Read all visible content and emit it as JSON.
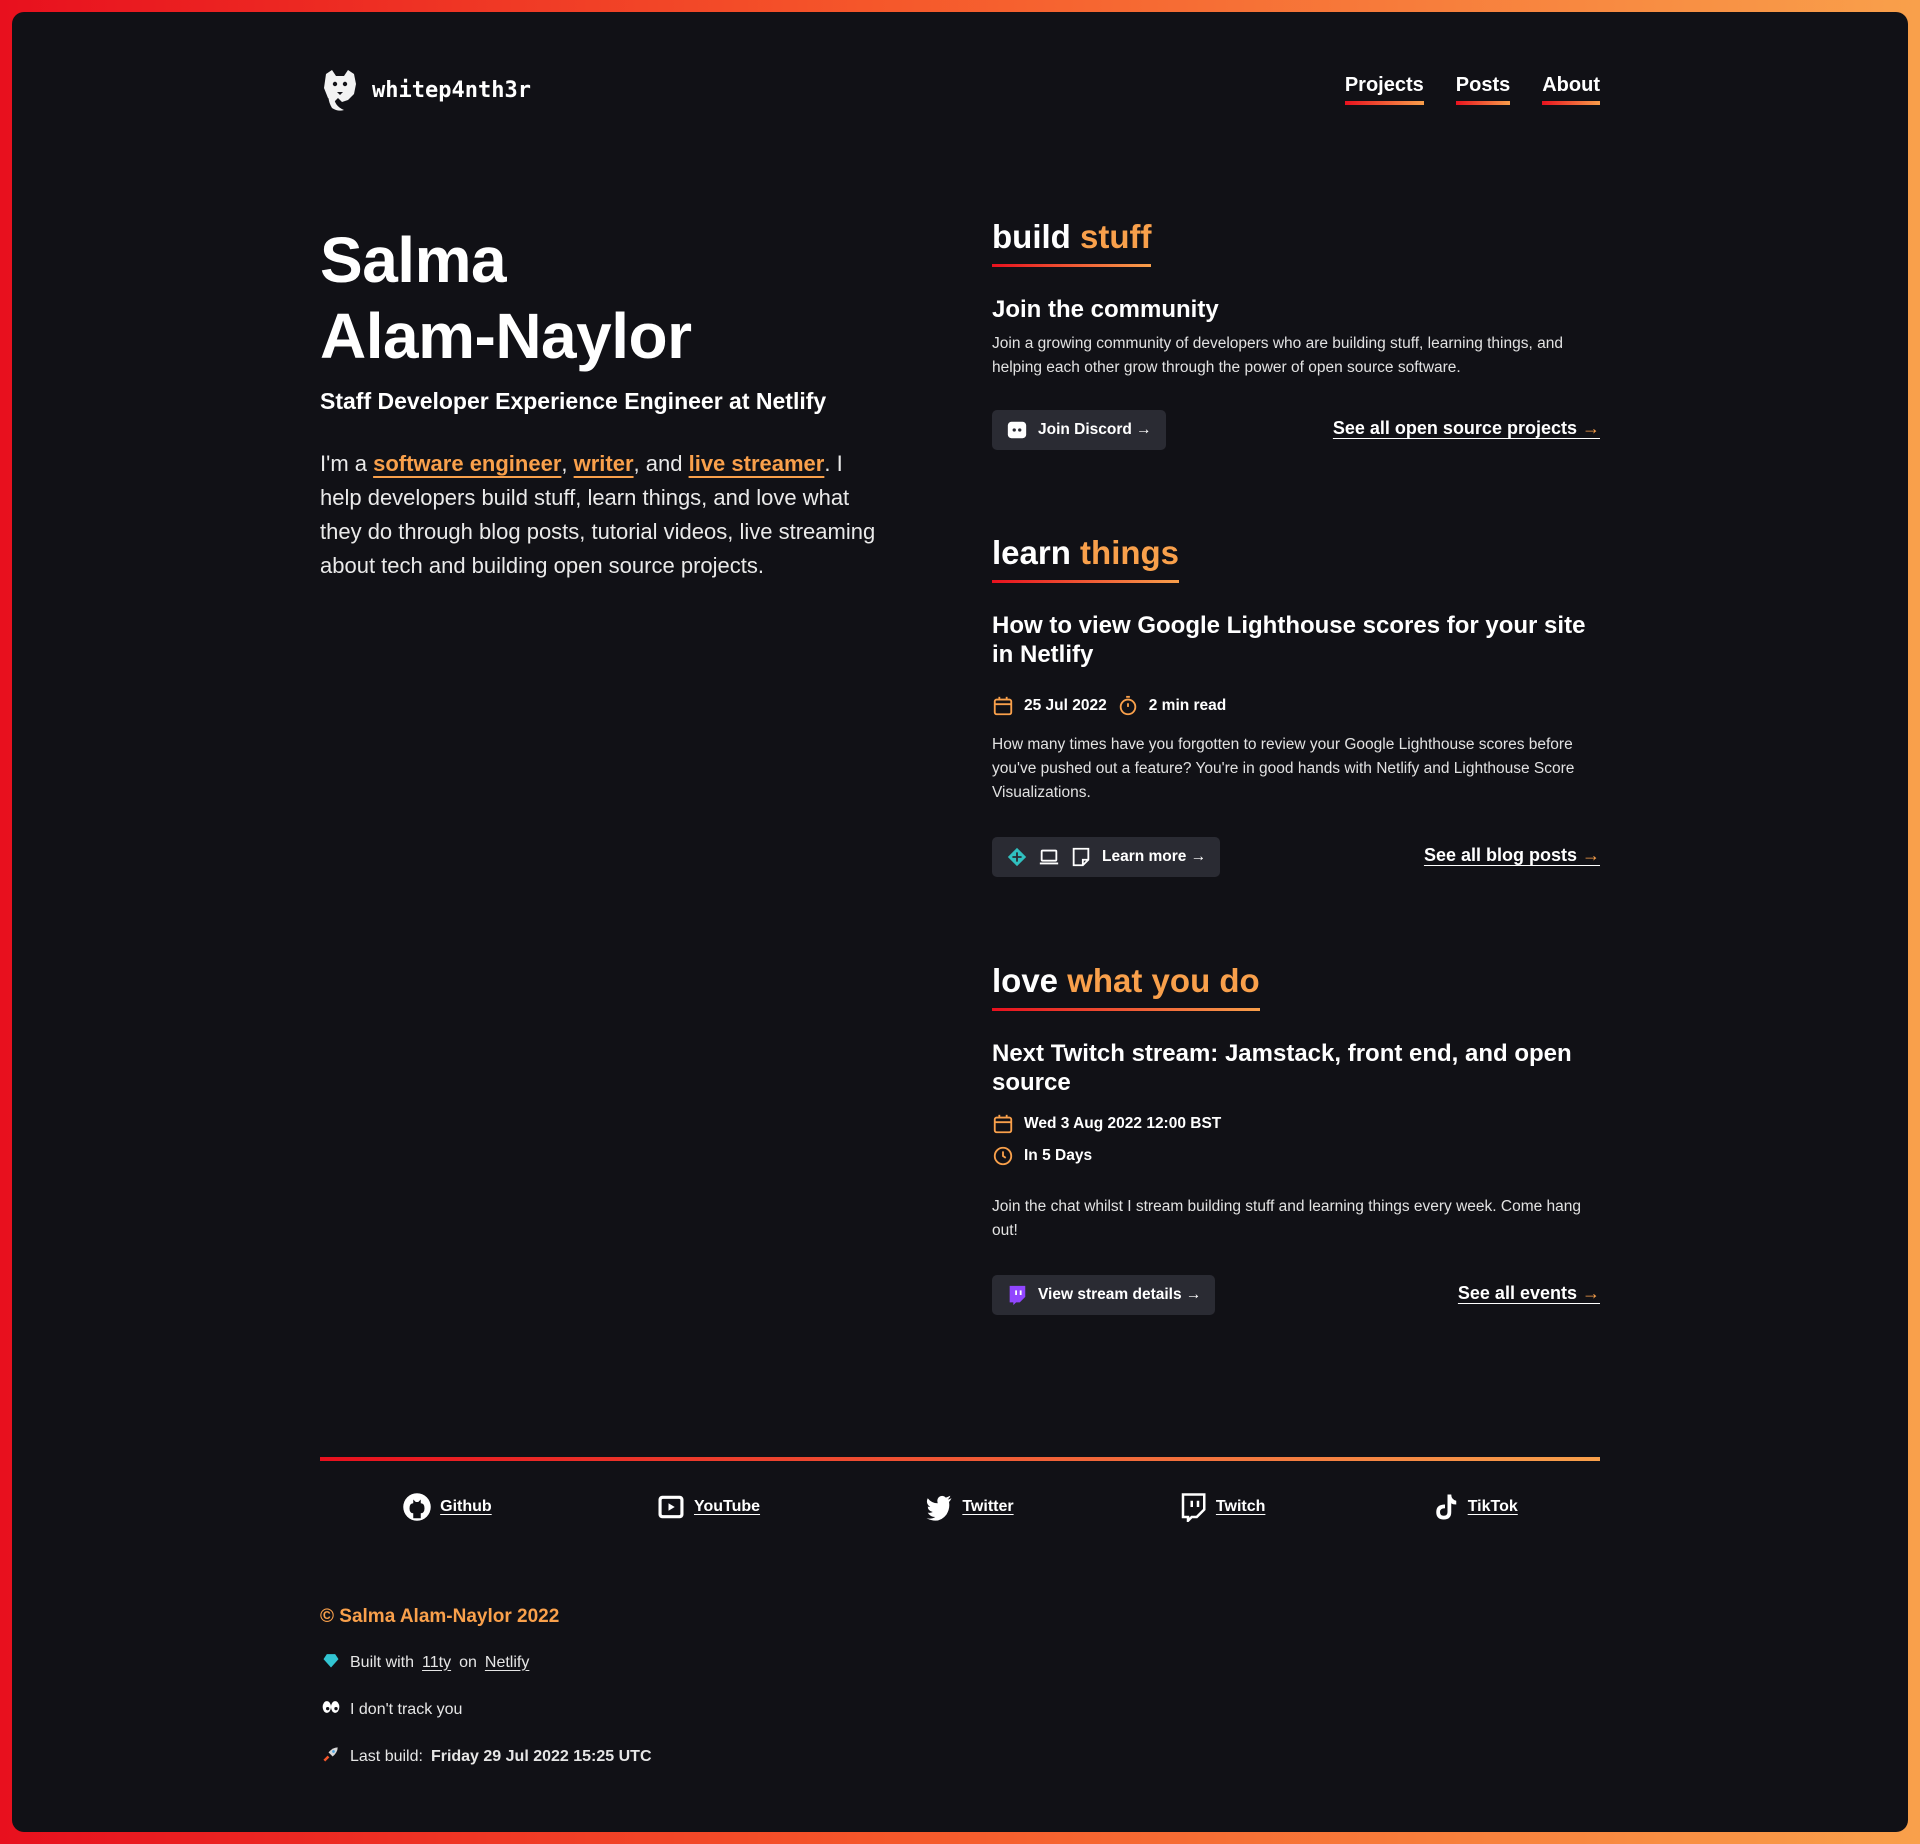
{
  "header": {
    "logo_text": "whitep4nth3r",
    "nav": [
      "Projects",
      "Posts",
      "About"
    ]
  },
  "hero": {
    "name_line1": "Salma",
    "name_line2": "Alam-Naylor",
    "role": "Staff Developer Experience Engineer at Netlify",
    "intro_prefix": "I'm a ",
    "link1": "software engineer",
    "sep1": ", ",
    "link2": "writer",
    "sep2": ", and ",
    "link3": "live streamer",
    "intro_suffix": ". I help developers build stuff, learn things, and love what they do through blog posts, tutorial videos, live streaming about tech and building open source projects."
  },
  "build": {
    "title_plain": "build",
    "title_accent": "stuff",
    "card_title": "Join the community",
    "card_text": "Join a growing community of developers who are building stuff, learning things, and helping each other grow through the power of open source software.",
    "button": "Join Discord →",
    "link": "See all open source projects",
    "link_arrow": "→"
  },
  "learn": {
    "title_plain": "learn",
    "title_accent": "things",
    "card_title": "How to view Google Lighthouse scores for your site in Netlify",
    "date": "25 Jul 2022",
    "read_time": "2 min read",
    "card_text": "How many times have you forgotten to review your Google Lighthouse scores before you've pushed out a feature? You're in good hands with Netlify and Lighthouse Score Visualizations.",
    "button": "Learn more →",
    "link": "See all blog posts",
    "link_arrow": "→"
  },
  "love": {
    "title_plain": "love",
    "title_accent": "what you do",
    "card_title": "Next Twitch stream: Jamstack, front end, and open source",
    "date": "Wed 3 Aug 2022 12:00 BST",
    "countdown": "In 5 Days",
    "card_text": "Join the chat whilst I stream building stuff and learning things every week. Come hang out!",
    "button": "View stream details →",
    "link": "See all events",
    "link_arrow": "→"
  },
  "social": [
    "Github",
    "YouTube",
    "Twitter",
    "Twitch",
    "TikTok"
  ],
  "footer": {
    "copyright": "© Salma Alam-Naylor 2022",
    "built_prefix": "Built with",
    "built_tool": "11ty",
    "built_on": "on",
    "built_host": "Netlify",
    "tracking": "I don't track you",
    "last_build_label": "Last build:",
    "last_build_value": "Friday 29 Jul 2022 15:25 UTC"
  },
  "colors": {
    "background": "#111116",
    "accent": "#f9a04b",
    "gradient_start": "#e8101e",
    "button_bg": "#2a2b33"
  }
}
